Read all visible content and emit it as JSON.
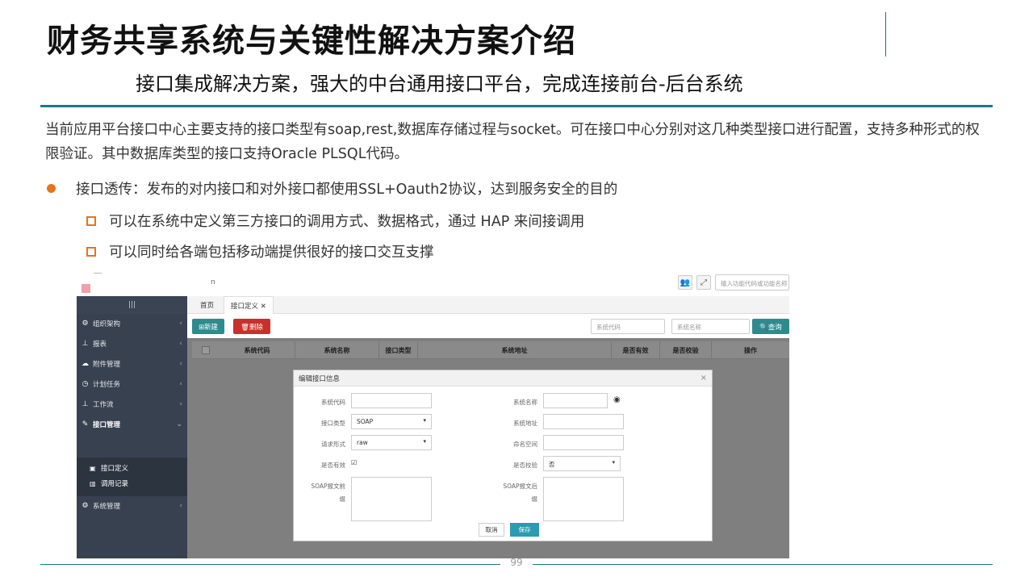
{
  "slide": {
    "title": "财务共享系统与关键性解决方案介绍",
    "subtitle": "接口集成解决方案，强大的中台通用接口平台，完成连接前台-后台系统",
    "paragraph": "当前应用平台接口中心主要支持的接口类型有soap,rest,数据库存储过程与socket。可在接口中心分别对这几种类型接口进行配置，支持多种形式的权限验证。其中数据库类型的接口支持Oracle PLSQL代码。",
    "bullet": "接口透传：发布的对内接口和对外接口都使用SSL+Oauth2协议，达到服务安全的目的",
    "sub_bullets": [
      "可以在系统中定义第三方接口的调用方式、数据格式，通过 HAP 来间接调用",
      "可以同时给各端包括移动端提供很好的接口交互支撑"
    ],
    "page_number": "99",
    "colors": {
      "accent_teal": "#1b7a84",
      "bullet_orange": "#e8731a"
    }
  },
  "app": {
    "top_n": "n",
    "top_search_placeholder": "输入功能代码或功能名称",
    "sidebar": {
      "menu_glyph": "|||",
      "items": [
        {
          "label": "组织架构",
          "icon": "sitemap-icon",
          "arrow": "‹"
        },
        {
          "label": "报表",
          "icon": "org-chart-icon",
          "arrow": "‹"
        },
        {
          "label": "附件管理",
          "icon": "cloud-icon",
          "arrow": "‹"
        },
        {
          "label": "计划任务",
          "icon": "clock-icon",
          "arrow": "‹"
        },
        {
          "label": "工作流",
          "icon": "workflow-icon",
          "arrow": "‹"
        },
        {
          "label": "接口管理",
          "icon": "plug-icon",
          "arrow": "⌄"
        },
        {
          "label": "系统管理",
          "icon": "gears-icon",
          "arrow": "‹"
        }
      ],
      "sub_items": [
        {
          "label": "接口定义",
          "icon": "file-icon"
        },
        {
          "label": "调用记录",
          "icon": "bar-chart-icon"
        }
      ]
    },
    "tabs": [
      {
        "label": "首页"
      },
      {
        "label": "接口定义 ✕"
      }
    ],
    "toolbar": {
      "new_label": "⊞新建",
      "delete_label": "🗑删除",
      "filter_code_placeholder": "系统代码",
      "filter_name_placeholder": "系统名称",
      "query_label": "🔍查询"
    },
    "table": {
      "columns": [
        "系统代码",
        "系统名称",
        "接口类型",
        "系统地址",
        "是否有效",
        "是否校验",
        "操作"
      ]
    },
    "modal": {
      "title": "编辑接口信息",
      "close": "×",
      "fields": {
        "system_code_label": "系统代码",
        "system_code_value": "",
        "system_name_label": "系统名称",
        "system_name_value": "",
        "interface_type_label": "接口类型",
        "interface_type_value": "SOAP",
        "system_address_label": "系统地址",
        "system_address_value": "",
        "request_form_label": "请求形式",
        "request_form_value": "raw",
        "namespace_label": "命名空间",
        "namespace_value": "",
        "is_valid_label": "是否有效",
        "is_valid_checked": "☑",
        "is_verify_label": "是否校验",
        "is_verify_value": "否",
        "soap_prefix_label_1": "SOAP报文前",
        "soap_prefix_label_2": "缀",
        "soap_suffix_label_1": "SOAP报文后",
        "soap_suffix_label_2": "缀"
      },
      "cancel_label": "取消",
      "save_label": "保存"
    }
  }
}
